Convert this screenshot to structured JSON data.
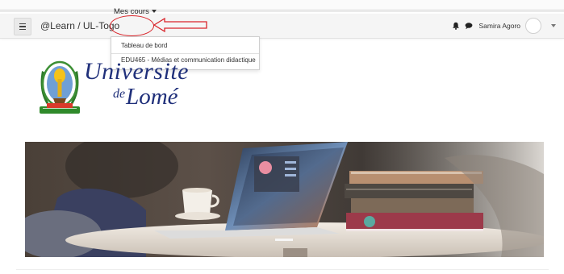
{
  "navbar": {
    "site_name": "@Learn / UL-Togo",
    "my_courses": "Mes cours",
    "user_name": "Samira Agoro"
  },
  "dropdown": {
    "items": [
      {
        "label": "Tableau de bord"
      },
      {
        "label": "EDU465 - Médias et communication didactique"
      }
    ]
  },
  "logo": {
    "line1": "Universite",
    "line2_prefix": "de",
    "line2": "Lomé"
  },
  "icons": {
    "menu": "hamburger-icon",
    "notifications": "bell-icon",
    "messages": "chat-icon",
    "user_menu": "chevron-down-icon"
  },
  "colors": {
    "navbar_bg": "#f5f5f5",
    "annotation_red": "#d9242a",
    "logo_blue": "#1f2f7a"
  }
}
